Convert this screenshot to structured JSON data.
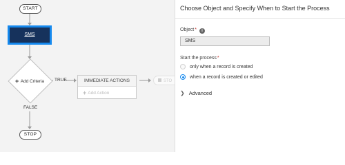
{
  "flow": {
    "start_label": "START",
    "sms_label": "SMS",
    "criteria_label": "Add Criteria",
    "true_label": "TRUE",
    "false_label": "FALSE",
    "immediate_actions_label": "IMMEDIATE ACTIONS",
    "add_action_label": "Add Action",
    "scheduled_label": "STO",
    "stop_label": "STOP"
  },
  "panel": {
    "title": "Choose Object and Specify When to Start the Process",
    "object_label": "Object",
    "required_mark": "*",
    "object_value": "SMS",
    "start_label": "Start the process",
    "options": [
      {
        "label": "only when a record is created",
        "selected": false
      },
      {
        "label": "when a record is created or edited",
        "selected": true
      }
    ],
    "advanced_label": "Advanced"
  },
  "colors": {
    "sms_node_bg": "#16325c",
    "selection_blue": "#1589ee",
    "required_red": "#c23934"
  }
}
